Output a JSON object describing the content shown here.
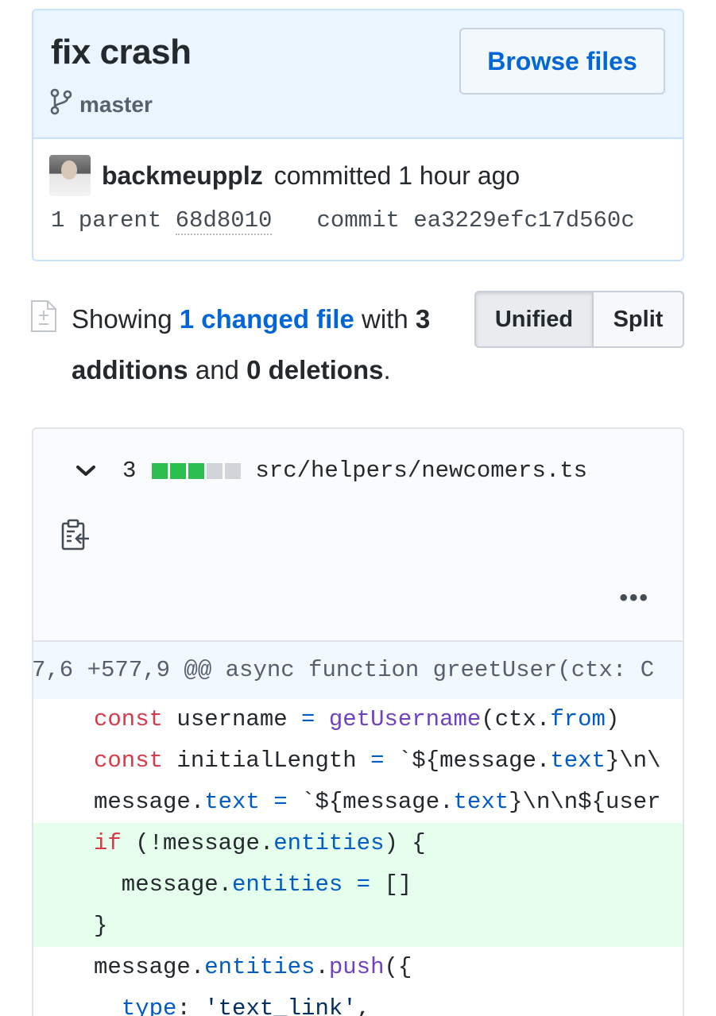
{
  "commit": {
    "title": "fix crash",
    "branch": "master",
    "browse_label": "Browse files",
    "author": "backmeupplz",
    "committed_text": "committed 1 hour ago",
    "parent_label": "1 parent",
    "parent_sha": "68d8010",
    "commit_label": "commit",
    "commit_sha": "ea3229efc17d560c"
  },
  "summary": {
    "showing": "Showing",
    "changed_files": "1 changed file",
    "with": "with",
    "additions_count": "3",
    "additions_word": "additions",
    "and": "and",
    "deletions_count": "0",
    "deletions_word": "deletions",
    "period": "."
  },
  "view_toggle": {
    "unified": "Unified",
    "split": "Split",
    "selected": "Unified"
  },
  "file": {
    "change_count": "3",
    "path": "src/helpers/newcomers.ts",
    "diffstat_colors": [
      "#2cbe4e",
      "#2cbe4e",
      "#2cbe4e",
      "#d1d5da",
      "#d1d5da"
    ],
    "more_label": "•••",
    "hunk_header": "7,6 +577,9 @@ async function greetUser(ctx: C",
    "lines": [
      {
        "type": "context",
        "text": "const username = getUsername(ctx.from)"
      },
      {
        "type": "context",
        "text": "const initialLength = `${message.text}\\n\\"
      },
      {
        "type": "context",
        "text": "message.text = `${message.text}\\n\\n${user"
      },
      {
        "type": "add",
        "text": "if (!message.entities) {"
      },
      {
        "type": "add",
        "text": "  message.entities = []"
      },
      {
        "type": "add",
        "text": "}"
      },
      {
        "type": "context",
        "text": "message.entities.push({"
      },
      {
        "type": "context",
        "text": "  type: 'text_link',"
      }
    ]
  }
}
